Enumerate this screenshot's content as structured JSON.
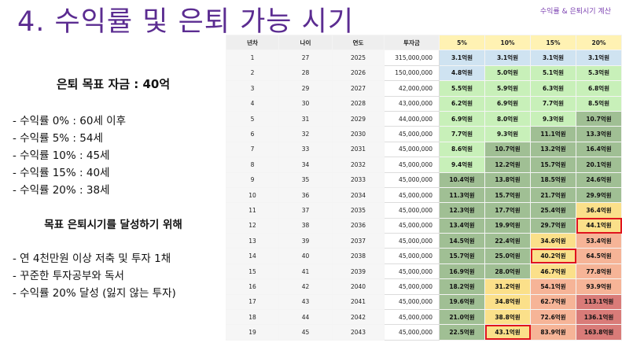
{
  "slide": {
    "title": "4. 수익률 및 은퇴 가능 시기",
    "header_tag": "수익률 & 은퇴시기 계산",
    "goal": "은퇴 목표 자금 : 40억",
    "rates": [
      "- 수익률  0% : 60세 이후",
      "- 수익률  5% : 54세",
      "- 수익률 10% : 45세",
      "- 수익률 15% : 40세",
      "- 수익률 20% : 38세"
    ],
    "subhead": "목표 은퇴시기를 달성하기 위해",
    "actions": [
      "- 연 4천만원 이상 저축 및 투자 1채",
      "- 꾸준한 투자공부와 독서",
      "- 수익률 20% 달성 (잃지 않는 투자)"
    ]
  },
  "table": {
    "headers": [
      "년차",
      "나이",
      "연도",
      "투자금",
      "5%",
      "10%",
      "15%",
      "20%"
    ],
    "rows": [
      [
        "1",
        "27",
        "2025",
        "315,000,000",
        "3.1억원",
        "3.1억원",
        "3.1억원",
        "3.1억원"
      ],
      [
        "2",
        "28",
        "2026",
        "150,000,000",
        "4.8억원",
        "5.0억원",
        "5.1억원",
        "5.3억원"
      ],
      [
        "3",
        "29",
        "2027",
        "42,000,000",
        "5.5억원",
        "5.9억원",
        "6.3억원",
        "6.8억원"
      ],
      [
        "4",
        "30",
        "2028",
        "43,000,000",
        "6.2억원",
        "6.9억원",
        "7.7억원",
        "8.5억원"
      ],
      [
        "5",
        "31",
        "2029",
        "44,000,000",
        "6.9억원",
        "8.0억원",
        "9.3억원",
        "10.7억원"
      ],
      [
        "6",
        "32",
        "2030",
        "45,000,000",
        "7.7억원",
        "9.3억원",
        "11.1억원",
        "13.3억원"
      ],
      [
        "7",
        "33",
        "2031",
        "45,000,000",
        "8.6억원",
        "10.7억원",
        "13.2억원",
        "16.4억원"
      ],
      [
        "8",
        "34",
        "2032",
        "45,000,000",
        "9.4억원",
        "12.2억원",
        "15.7억원",
        "20.1억원"
      ],
      [
        "9",
        "35",
        "2033",
        "45,000,000",
        "10.4억원",
        "13.8억원",
        "18.5억원",
        "24.6억원"
      ],
      [
        "10",
        "36",
        "2034",
        "45,000,000",
        "11.3억원",
        "15.7억원",
        "21.7억원",
        "29.9억원"
      ],
      [
        "11",
        "37",
        "2035",
        "45,000,000",
        "12.3억원",
        "17.7억원",
        "25.4억원",
        "36.4억원"
      ],
      [
        "12",
        "38",
        "2036",
        "45,000,000",
        "13.4억원",
        "19.9억원",
        "29.7억원",
        "44.1억원"
      ],
      [
        "13",
        "39",
        "2037",
        "45,000,000",
        "14.5억원",
        "22.4억원",
        "34.6억원",
        "53.4억원"
      ],
      [
        "14",
        "40",
        "2038",
        "45,000,000",
        "15.7억원",
        "25.0억원",
        "40.2억원",
        "64.5억원"
      ],
      [
        "15",
        "41",
        "2039",
        "45,000,000",
        "16.9억원",
        "28.0억원",
        "46.7억원",
        "77.8억원"
      ],
      [
        "16",
        "42",
        "2040",
        "45,000,000",
        "18.2억원",
        "31.2억원",
        "54.1억원",
        "93.9억원"
      ],
      [
        "17",
        "43",
        "2041",
        "45,000,000",
        "19.6억원",
        "34.8억원",
        "62.7억원",
        "113.1억원"
      ],
      [
        "18",
        "44",
        "2042",
        "45,000,000",
        "21.0억원",
        "38.8억원",
        "72.6억원",
        "136.1억원"
      ],
      [
        "19",
        "45",
        "2043",
        "45,000,000",
        "22.5억원",
        "43.1억원",
        "83.9억원",
        "163.8억원"
      ]
    ],
    "highlight_cells": [
      [
        11,
        7
      ],
      [
        13,
        6
      ],
      [
        18,
        5
      ]
    ],
    "colors": {
      "title": "#5b2c91",
      "header_base": "#eeeeee",
      "header_rate": "#fff2b3",
      "blue": "#cfe3f1",
      "light_green": "#c8f0b9",
      "sage": "#a0bf94",
      "yellow": "#fbe08a",
      "salmon": "#f6b497",
      "red": "#d97b78",
      "highlight_border": "#e0141e"
    }
  }
}
